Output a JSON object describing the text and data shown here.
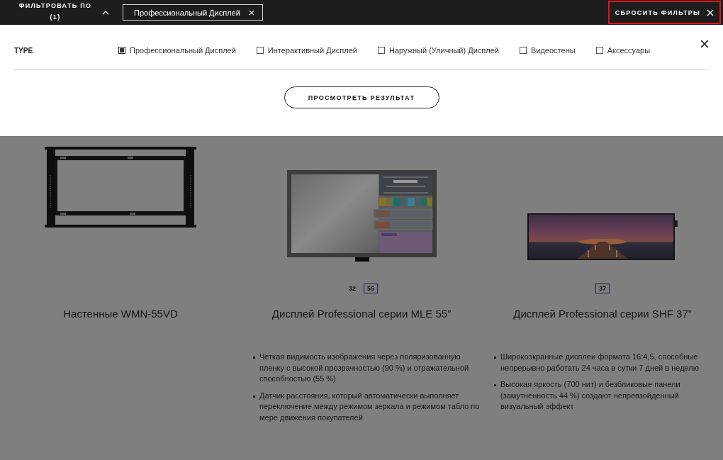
{
  "filter_bar": {
    "title": "ФИЛЬТРОВАТЬ ПО",
    "count": "(1)",
    "expanded": true,
    "chips": [
      {
        "label": "Профессиональный Дисплей"
      }
    ],
    "reset_button": {
      "label": "СБРОСИТЬ ФИЛЬТРЫ",
      "focused": true
    }
  },
  "filter_panel": {
    "groups": [
      {
        "title": "TYPE",
        "options": [
          {
            "label": "Профессиональный Дисплей",
            "checked": true
          },
          {
            "label": "Интерактивный Дисплей",
            "checked": false
          },
          {
            "label": "Наружный (Уличный) Дисплей",
            "checked": false
          },
          {
            "label": "Видеостены",
            "checked": false
          },
          {
            "label": "Аксессуары",
            "checked": false
          }
        ]
      }
    ],
    "apply_button": "ПРОСМОТРЕТЬ РЕЗУЛЬТАТ"
  },
  "products": [
    {
      "kind": "wall-mount",
      "title": "Настенные WMN-55VD"
    },
    {
      "kind": "display",
      "sizes": [
        {
          "label": "32",
          "selected": false
        },
        {
          "label": "55",
          "selected": true
        }
      ],
      "title": "Дисплей Professional серии MLE 55”",
      "features": [
        "Четкая видимость изображения через поляризованную пленку с высокой прозрачностью (90 %) и отражательной способностью (55 %)",
        "Датчик расстояния, который автоматически выполняет переключение между режимом зеркала и режимом табло по мере движения покупателей"
      ]
    },
    {
      "kind": "stretched-display",
      "sizes": [
        {
          "label": "37",
          "selected": true
        }
      ],
      "title": "Дисплей Professional серии SHF 37”",
      "features": [
        "Широкоэкранные дисплеи формата 16:4,5, способные непрерывно работать 24 часа в сутки 7 дней в неделю",
        "Высокая яркость (700 нит) и безбликовые панели (замутненность 44 %) создают непревзойденный визуальный эффект"
      ]
    }
  ]
}
